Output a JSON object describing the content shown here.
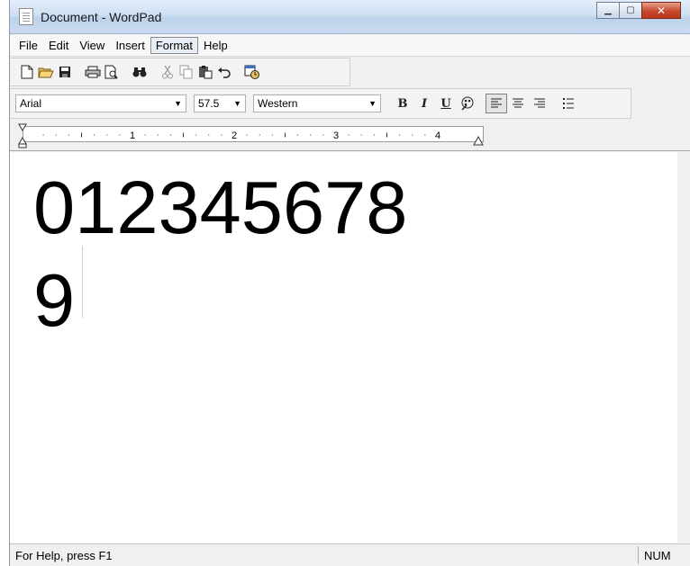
{
  "window": {
    "title": "Document - WordPad"
  },
  "menu": {
    "items": [
      "File",
      "Edit",
      "View",
      "Insert",
      "Format",
      "Help"
    ],
    "active": "Format"
  },
  "toolbar": {
    "icons": [
      "new-document-icon",
      "open-folder-icon",
      "save-disk-icon",
      "print-icon",
      "print-preview-icon",
      "find-binoculars-icon",
      "cut-scissors-icon",
      "copy-icon",
      "paste-icon",
      "undo-icon",
      "insert-datetime-icon"
    ]
  },
  "format": {
    "font": "Arial",
    "size": "57.5",
    "script": "Western",
    "bold_label": "B",
    "italic_label": "I",
    "underline_label": "U"
  },
  "ruler": {
    "numbers": [
      "1",
      "2",
      "3",
      "4"
    ]
  },
  "document": {
    "line1": "012345678",
    "line2": "9"
  },
  "status": {
    "help": "For Help, press F1",
    "num": "NUM"
  }
}
